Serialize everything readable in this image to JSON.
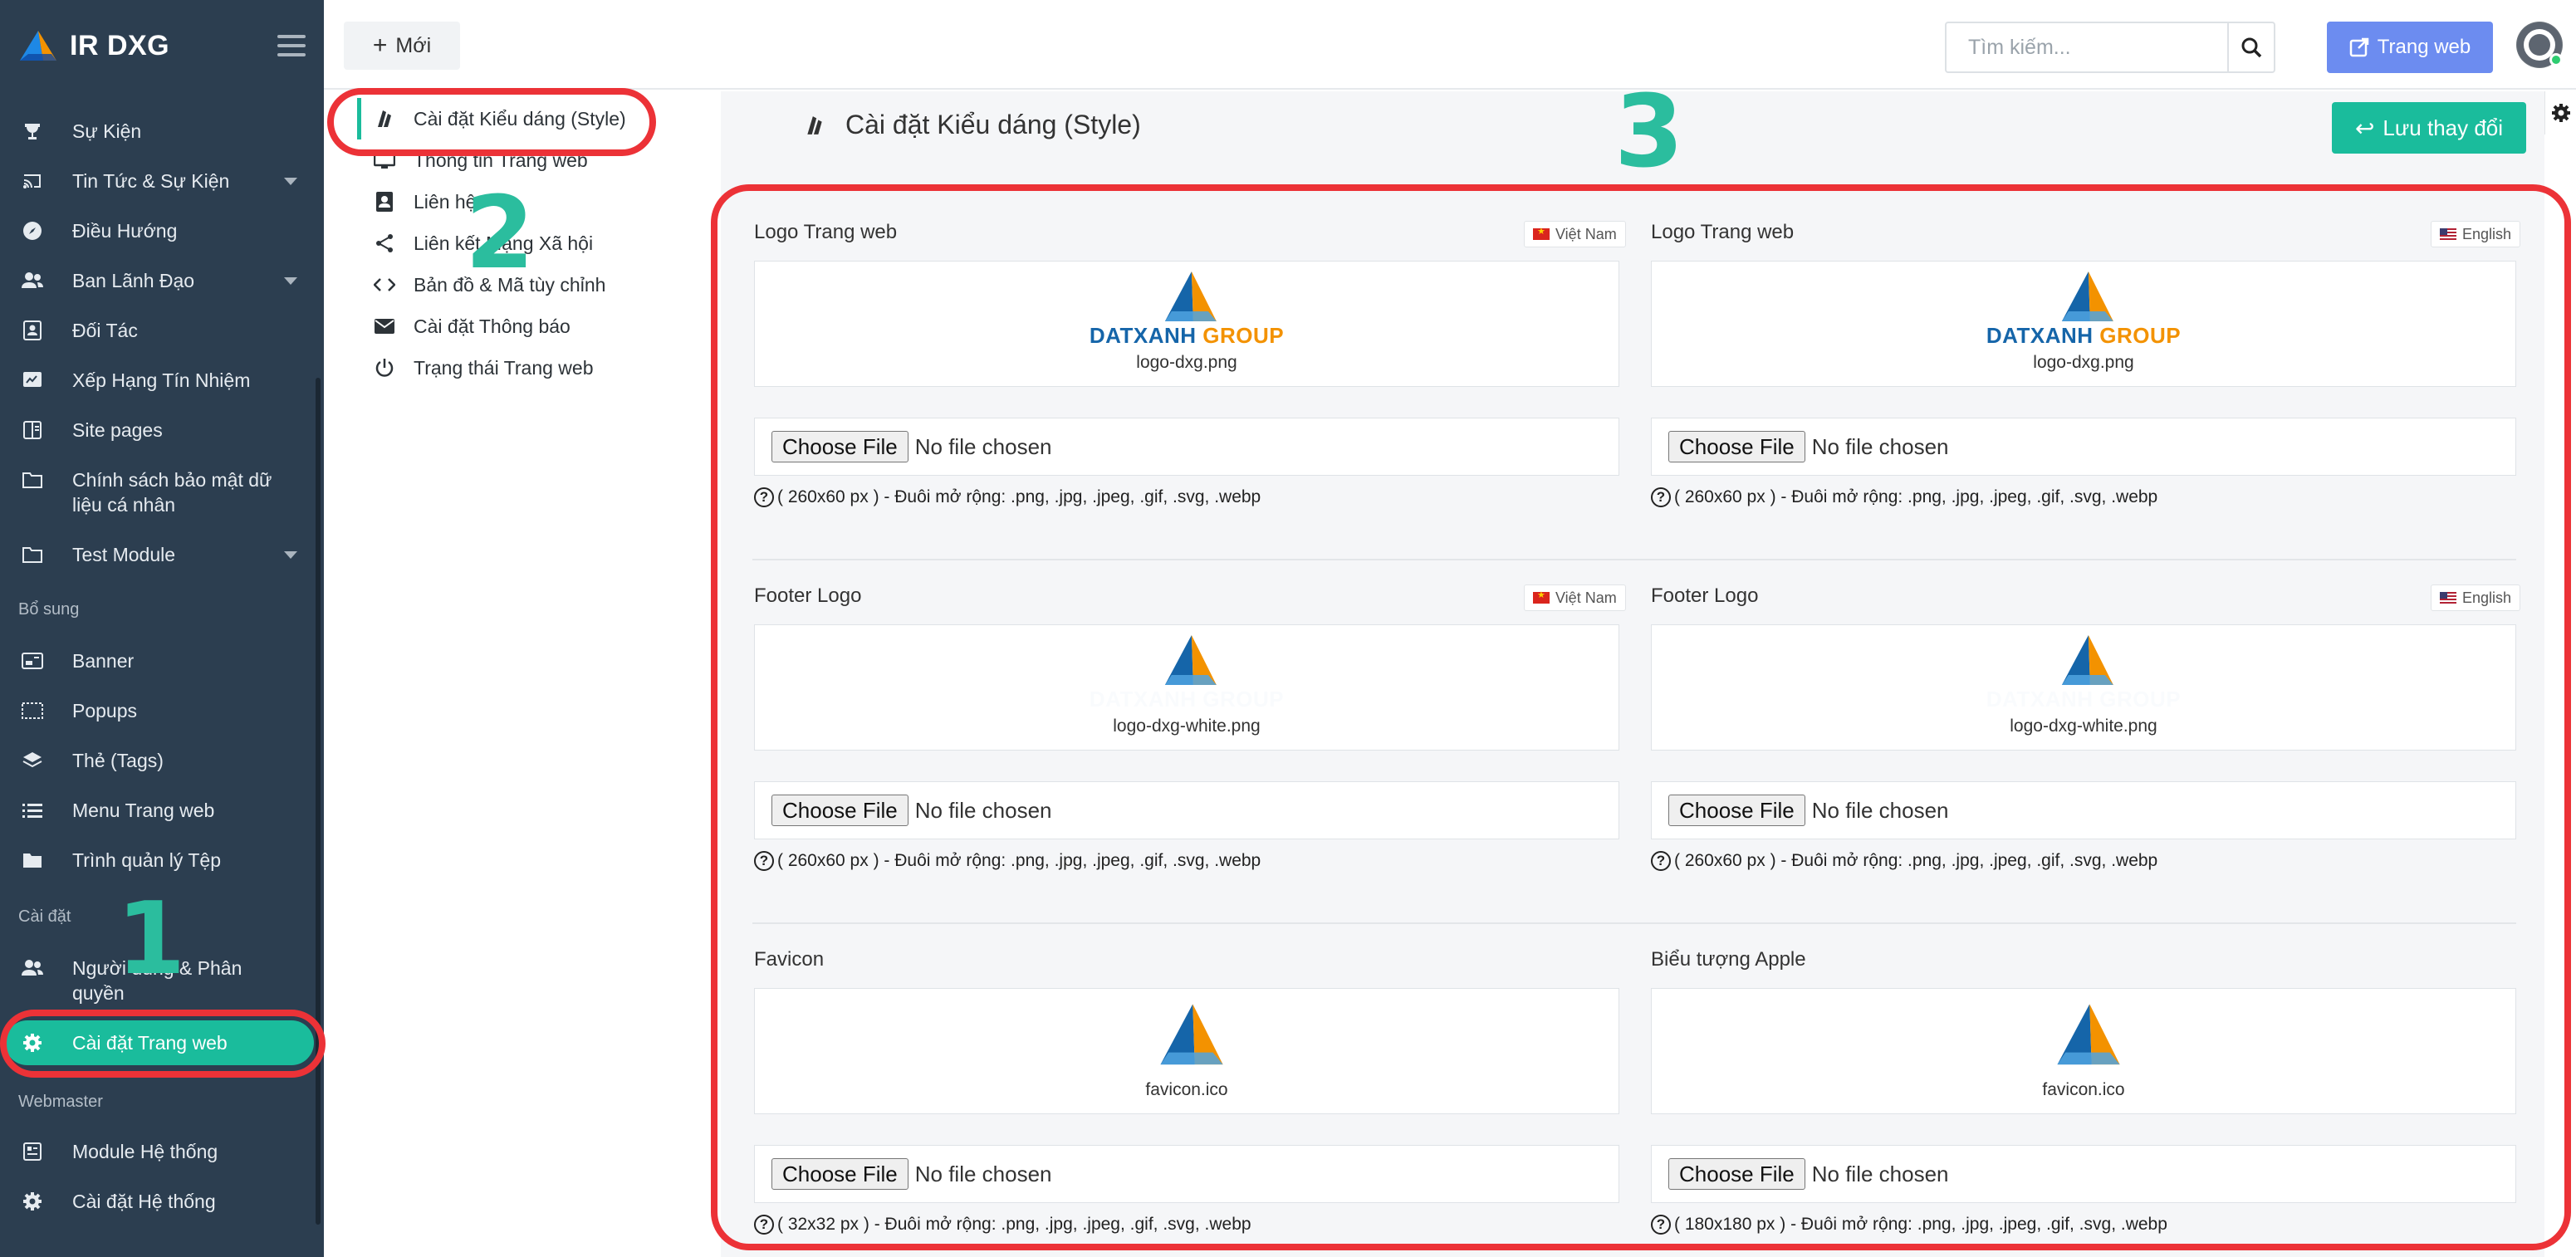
{
  "brand": {
    "title": "IR DXG"
  },
  "colors": {
    "sidebar_bg": "#2c3e50",
    "accent": "#1abc9c",
    "web_button": "#6c8cf0",
    "annotation_red": "#ec3237",
    "annotation_number": "#2bbd9e"
  },
  "sidebar": {
    "items": [
      {
        "label": "Sự Kiện",
        "icon": "trophy-icon"
      },
      {
        "label": "Tin Tức & Sự Kiện",
        "icon": "cast-icon"
      },
      {
        "label": "Điều Hướng",
        "icon": "compass-icon"
      },
      {
        "label": "Ban Lãnh Đạo",
        "icon": "users-icon"
      },
      {
        "label": "Đối Tác",
        "icon": "contact-card-icon"
      },
      {
        "label": "Xếp Hạng Tín Nhiệm",
        "icon": "rating-icon"
      },
      {
        "label": "Site pages",
        "icon": "pages-icon"
      },
      {
        "label": "Chính sách bảo mật dữ",
        "label2": "liệu cá nhân",
        "icon": "folder-icon"
      },
      {
        "label": "Test Module",
        "icon": "folder-icon"
      },
      {
        "label": "Banner",
        "icon": "banner-icon"
      },
      {
        "label": "Popups",
        "icon": "popup-icon"
      },
      {
        "label": "Thẻ (Tags)",
        "icon": "layers-icon"
      },
      {
        "label": "Menu Trang web",
        "icon": "list-icon"
      },
      {
        "label": "Trình quản lý Tệp",
        "icon": "folder-icon"
      },
      {
        "label": "Người dùng & Phân",
        "label2": "quyền",
        "icon": "users-icon"
      },
      {
        "label": "Cài đặt Trang web",
        "icon": "gear-icon"
      },
      {
        "label": "Module Hệ thống",
        "icon": "module-icon"
      },
      {
        "label": "Cài đặt Hệ thống",
        "icon": "gear-icon"
      }
    ],
    "sections": {
      "extra": "Bổ sung",
      "settings": "Cài đặt",
      "webmaster": "Webmaster"
    }
  },
  "topbar": {
    "new_label": "Mới",
    "search_placeholder": "Tìm kiếm...",
    "website_label": "Trang web"
  },
  "subnav": {
    "items": [
      "Cài đặt Kiểu dáng (Style)",
      "Thông tin Trang web",
      "Liên hệ",
      "Liên kết Mạng Xã hội",
      "Bản đồ & Mã tùy chỉnh",
      "Cài đặt Thông báo",
      "Trạng thái Trang web"
    ]
  },
  "main": {
    "title": "Cài đặt Kiểu dáng (Style)",
    "save_label": "Lưu thay đổi",
    "choose_file": "Choose File",
    "no_file": "No file chosen",
    "lang_vn": "Việt Nam",
    "lang_en": "English",
    "logo_brand_a": "DATXANH",
    "logo_brand_b": "GROUP",
    "fields": [
      {
        "label": "Logo Trang web",
        "file": "logo-dxg.png",
        "hint": "( 260x60 px ) - Đuôi mở rộng: .png, .jpg, .jpeg, .gif, .svg, .webp"
      },
      {
        "label": "Logo Trang web",
        "file": "logo-dxg.png",
        "hint": "( 260x60 px ) - Đuôi mở rộng: .png, .jpg, .jpeg, .gif, .svg, .webp"
      },
      {
        "label": "Footer Logo",
        "file": "logo-dxg-white.png",
        "hint": "( 260x60 px ) - Đuôi mở rộng: .png, .jpg, .jpeg, .gif, .svg, .webp"
      },
      {
        "label": "Footer Logo",
        "file": "logo-dxg-white.png",
        "hint": "( 260x60 px ) - Đuôi mở rộng: .png, .jpg, .jpeg, .gif, .svg, .webp"
      },
      {
        "label": "Favicon",
        "file": "favicon.ico",
        "hint": "( 32x32 px ) - Đuôi mở rộng: .png, .jpg, .jpeg, .gif, .svg, .webp"
      },
      {
        "label": "Biểu tượng Apple",
        "file": "favicon.ico",
        "hint": "( 180x180 px ) - Đuôi mở rộng: .png, .jpg, .jpeg, .gif, .svg, .webp"
      }
    ]
  },
  "annotations": {
    "n1": "1",
    "n2": "2",
    "n3": "3"
  }
}
